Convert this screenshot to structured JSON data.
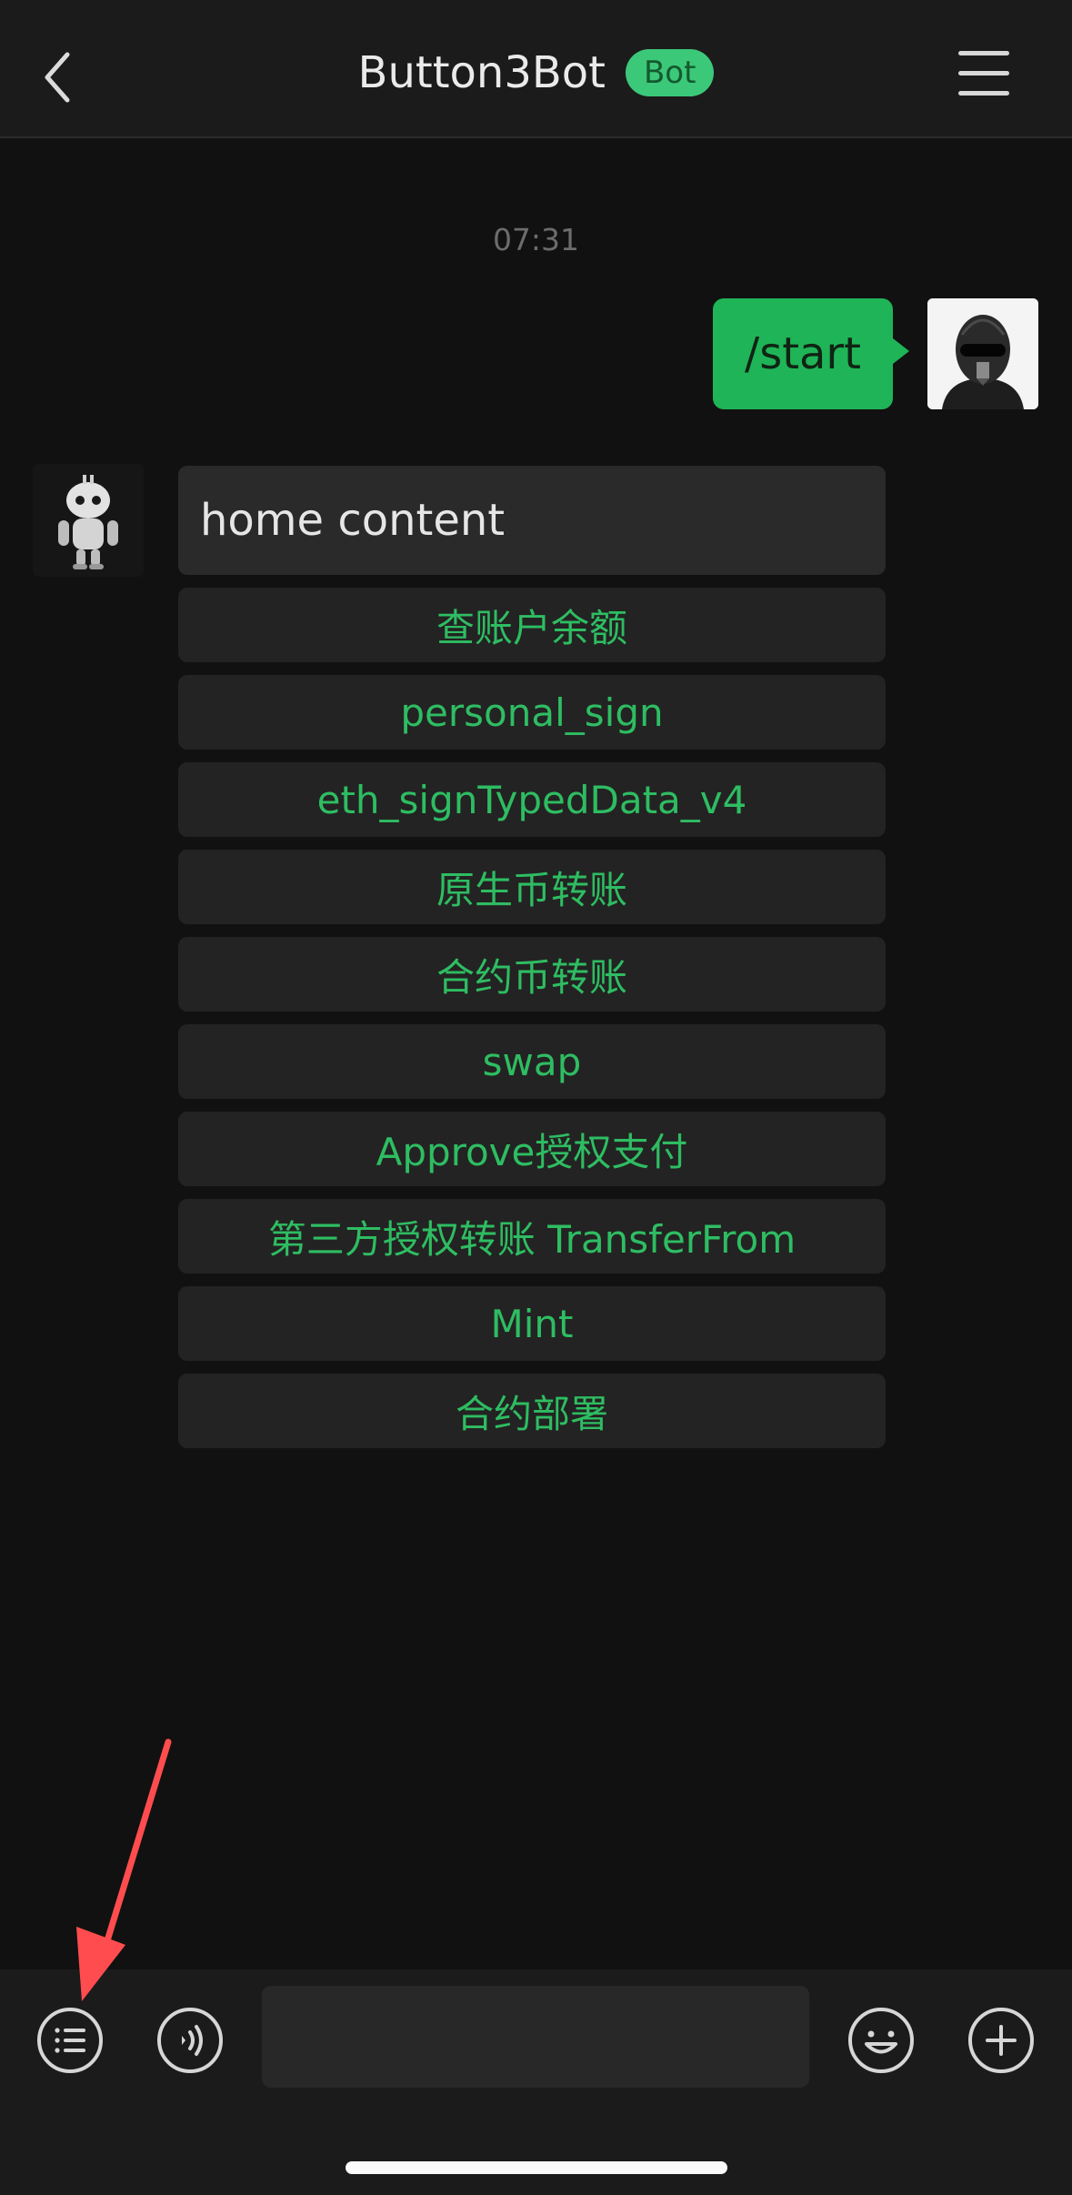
{
  "header": {
    "title": "Button3Bot",
    "badge": "Bot",
    "back_icon": "chevron-left-icon",
    "menu_icon": "hamburger-menu-icon"
  },
  "chat": {
    "timestamp": "07:31",
    "user_message": "/start",
    "bot_message": "home content",
    "buttons": [
      "查账户余额",
      "personal_sign",
      "eth_signTypedData_v4",
      "原生币转账",
      "合约币转账",
      "swap",
      "Approve授权支付",
      "第三方授权转账 TransferFrom",
      "Mint",
      "合约部署"
    ]
  },
  "input_bar": {
    "menu_icon": "list-icon",
    "voice_icon": "voice-icon",
    "emoji_icon": "emoji-icon",
    "plus_icon": "plus-icon",
    "placeholder": ""
  },
  "colors": {
    "accent": "#1fb457",
    "button_text": "#2ebd62",
    "annotation_arrow": "#ff4d4f"
  }
}
